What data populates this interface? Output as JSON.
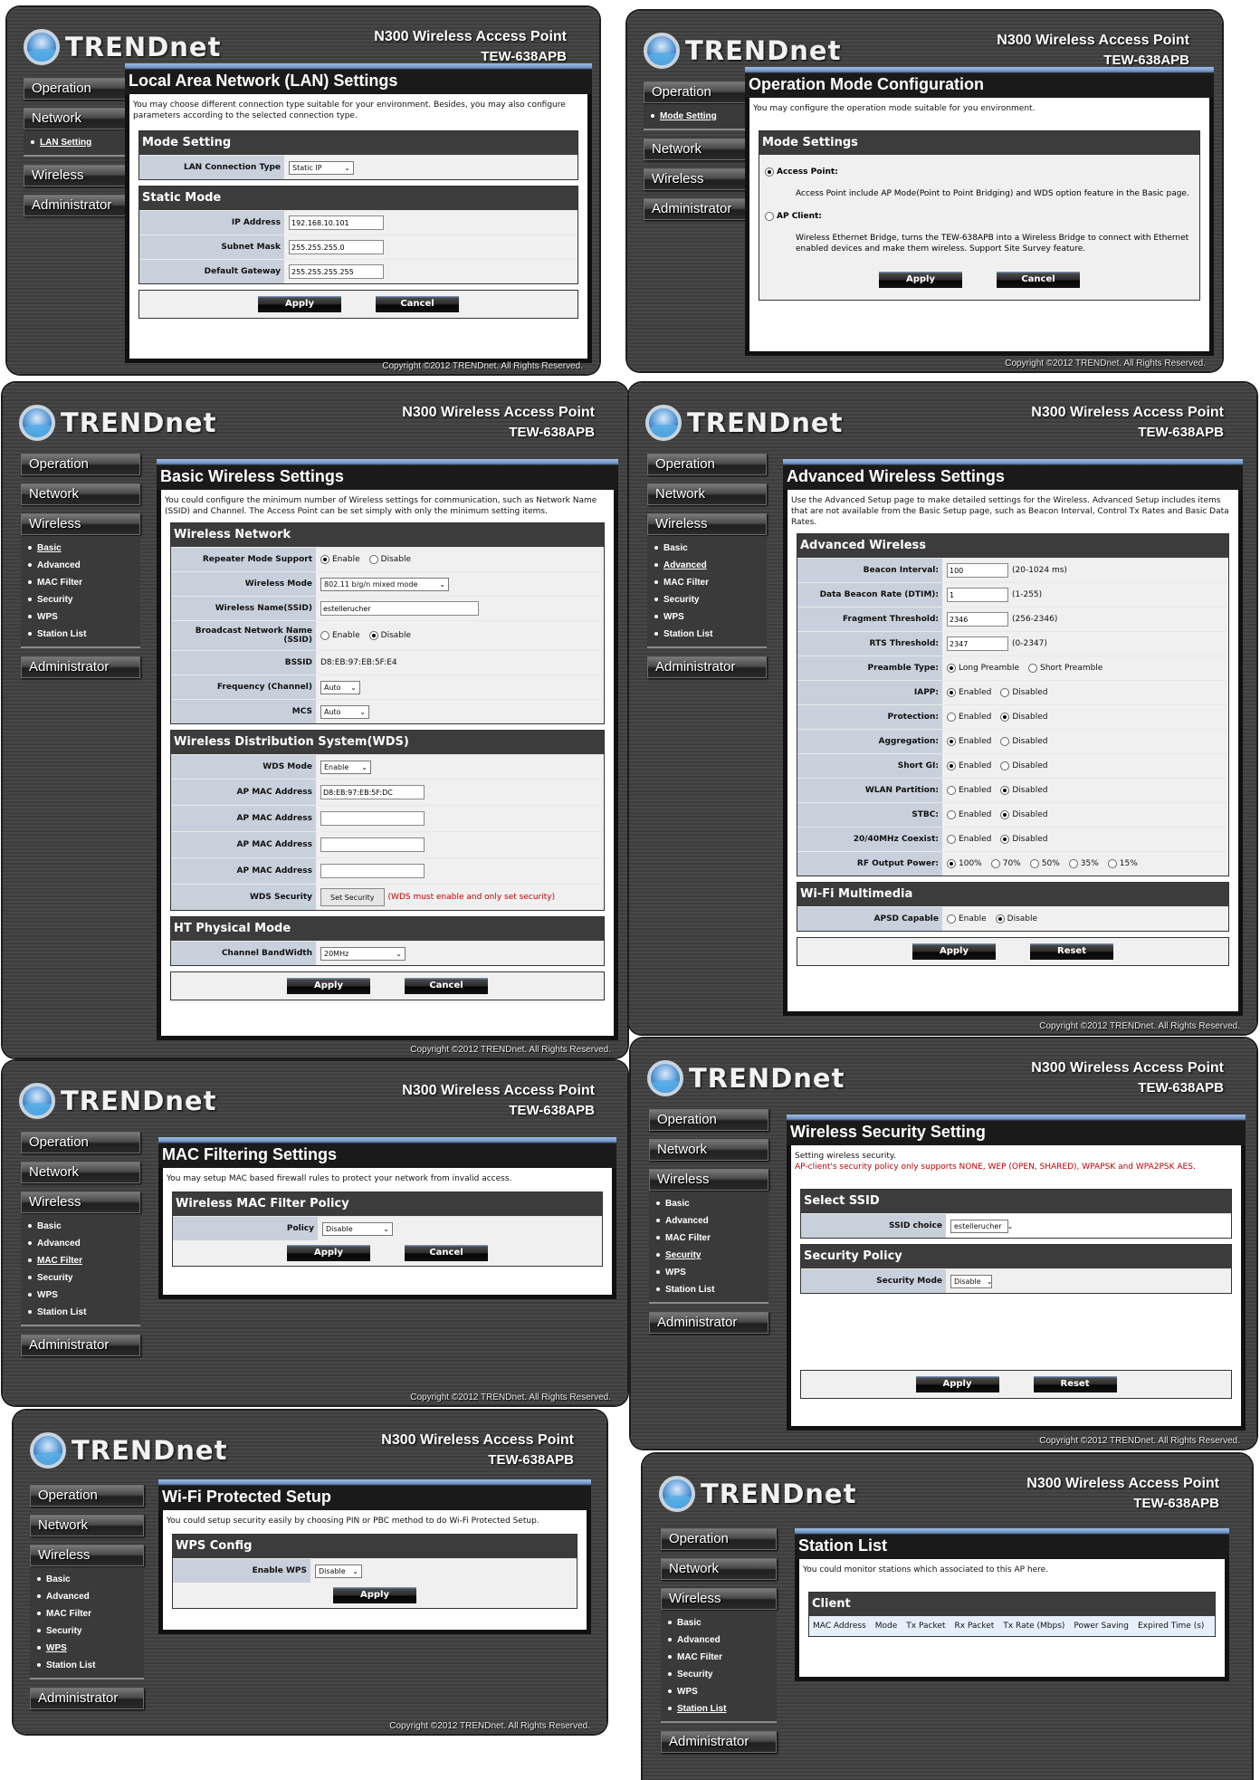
{
  "brand": {
    "logo_text": "TRENDnet",
    "product_name": "N300 Wireless Access Point",
    "model": "TEW-638APB",
    "copyright": "Copyright ©2012 TRENDnet. All Rights Reserved."
  },
  "nav": {
    "operation": "Operation",
    "network": "Network",
    "wireless": "Wireless",
    "administrator": "Administrator",
    "operation_sub": [
      "Mode Setting"
    ],
    "network_sub": [
      "LAN Setting"
    ],
    "wireless_sub": [
      "Basic",
      "Advanced",
      "MAC Filter",
      "Security",
      "WPS",
      "Station List"
    ]
  },
  "buttons": {
    "apply": "Apply",
    "cancel": "Cancel",
    "reset": "Reset"
  },
  "lan": {
    "title": "Local Area Network (LAN) Settings",
    "intro": "You may choose different connection type suitable for your environment. Besides, you may also configure parameters according to the selected connection type.",
    "mode_section": "Mode Setting",
    "conn_type_label": "LAN Connection Type",
    "conn_type_value": "Static IP",
    "static_section": "Static Mode",
    "ip_label": "IP Address",
    "ip_value": "192.168.10.101",
    "mask_label": "Subnet Mask",
    "mask_value": "255.255.255.0",
    "gw_label": "Default Gateway",
    "gw_value": "255.255.255.255"
  },
  "opmode": {
    "title": "Operation Mode Configuration",
    "intro": "You may configure the operation mode suitable for you environment.",
    "section": "Mode Settings",
    "ap_label": "Access Point:",
    "ap_desc": "Access Point include AP Mode(Point to Point Bridging) and WDS option feature in the Basic page.",
    "client_label": "AP Client:",
    "client_desc": "Wireless Ethernet Bridge, turns the TEW-638APB into a Wireless Bridge to connect with Ethernet enabled devices and make them wireless. Support Site Survey feature.",
    "selected": "Access Point"
  },
  "basic": {
    "title": "Basic Wireless Settings",
    "intro": "You could configure the minimum number of Wireless settings for communication, such as Network Name (SSID) and Channel. The Access Point can be set simply with only the minimum setting items.",
    "wn_section": "Wireless Network",
    "repeater_label": "Repeater Mode Support",
    "enable": "Enable",
    "disable": "Disable",
    "repeater_value": "Enable",
    "mode_label": "Wireless Mode",
    "mode_value": "802.11 b/g/n mixed mode",
    "ssid_label": "Wireless Name(SSID)",
    "ssid_value": "estellerucher",
    "broadcast_label": "Broadcast Network Name (SSID)",
    "broadcast_value": "Disable",
    "bssid_label": "BSSID",
    "bssid_value": "D8:EB:97:EB:5F:E4",
    "freq_label": "Frequency (Channel)",
    "freq_value": "Auto",
    "mcs_label": "MCS",
    "mcs_value": "Auto",
    "wds_section": "Wireless Distribution System(WDS)",
    "wds_mode_label": "WDS Mode",
    "wds_mode_value": "Enable",
    "ap_mac_label": "AP MAC Address",
    "ap_mac_values": [
      "D8:EB:97:EB:5F:DC",
      "",
      "",
      ""
    ],
    "wds_security_label": "WDS Security",
    "set_security": "Set Security",
    "wds_note": "(WDS must enable and only set security)",
    "ht_section": "HT Physical Mode",
    "bw_label": "Channel BandWidth",
    "bw_value": "20MHz"
  },
  "advanced": {
    "title": "Advanced Wireless Settings",
    "intro": "Use the Advanced Setup page to make detailed settings for the Wireless. Advanced Setup includes items that are not available from the Basic Setup page, such as Beacon Interval, Control Tx Rates and Basic Data Rates.",
    "section": "Advanced Wireless",
    "beacon_label": "Beacon Interval:",
    "beacon_value": "100",
    "beacon_range": "(20-1024 ms)",
    "dtim_label": "Data Beacon Rate (DTIM):",
    "dtim_value": "1",
    "dtim_range": "(1-255)",
    "frag_label": "Fragment Threshold:",
    "frag_value": "2346",
    "frag_range": "(256-2346)",
    "rts_label": "RTS Threshold:",
    "rts_value": "2347",
    "rts_range": "(0-2347)",
    "preamble_label": "Preamble Type:",
    "preamble_long": "Long Preamble",
    "preamble_short": "Short Preamble",
    "preamble_value": "Long Preamble",
    "enabled": "Enabled",
    "disabled": "Disabled",
    "toggles": [
      {
        "label": "IAPP:",
        "value": "Enabled"
      },
      {
        "label": "Protection:",
        "value": "Disabled"
      },
      {
        "label": "Aggregation:",
        "value": "Enabled"
      },
      {
        "label": "Short GI:",
        "value": "Enabled"
      },
      {
        "label": "WLAN Partition:",
        "value": "Disabled"
      },
      {
        "label": "STBC:",
        "value": "Disabled"
      },
      {
        "label": "20/40MHz Coexist:",
        "value": "Disabled"
      }
    ],
    "rf_label": "RF Output Power:",
    "rf_options": [
      "100%",
      "70%",
      "50%",
      "35%",
      "15%"
    ],
    "rf_value": "100%",
    "wmm_section": "Wi-Fi Multimedia",
    "apsd_label": "APSD Capable",
    "apsd_enable": "Enable",
    "apsd_disable": "Disable",
    "apsd_value": "Disable"
  },
  "mac": {
    "title": "MAC Filtering Settings",
    "intro": "You may setup MAC based firewall rules to protect your network from invalid access.",
    "section": "Wireless MAC Filter Policy",
    "policy_label": "Policy",
    "policy_value": "Disable"
  },
  "security": {
    "title": "Wireless Security Setting",
    "intro": "Setting wireless security.",
    "warning": "AP-client's security policy only supports NONE, WEP (OPEN, SHARED), WPAPSK and WPA2PSK AES.",
    "ssid_section": "Select SSID",
    "ssid_label": "SSID choice",
    "ssid_value": "estellerucher",
    "policy_section": "Security Policy",
    "mode_label": "Security Mode",
    "mode_value": "Disable"
  },
  "wps": {
    "title": "Wi-Fi Protected Setup",
    "intro": "You could setup security easily by choosing PIN or PBC method to do Wi-Fi Protected Setup.",
    "section": "WPS Config",
    "enable_label": "Enable WPS",
    "enable_value": "Disable"
  },
  "station": {
    "title": "Station List",
    "intro": "You could monitor stations which associated to this AP here.",
    "section": "Client",
    "columns": [
      "MAC Address",
      "Mode",
      "Tx Packet",
      "Rx Packet",
      "Tx Rate (Mbps)",
      "Power Saving",
      "Expired Time (s)"
    ]
  }
}
